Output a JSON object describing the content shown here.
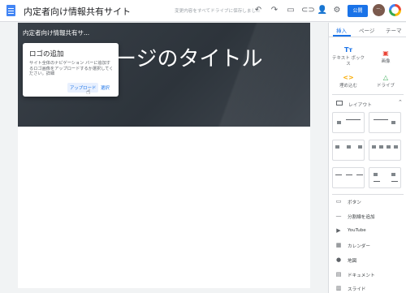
{
  "app": {
    "site_title": "内定者向け情報共有サイト",
    "save_status": "変更内容をすべてドライブに保存しました",
    "publish_label": "公開",
    "avatar_text": "ー·",
    "colors": {
      "accent": "#1a73e8",
      "banner": "#363d44",
      "doc_icon": "#4285f4"
    },
    "toolbar_icons": [
      "undo-icon",
      "redo-icon",
      "preview-devices-icon",
      "insert-link-icon",
      "add-editor-icon",
      "settings-icon",
      "more-vert-icon"
    ]
  },
  "canvas": {
    "banner_site_name": "内定者向け情報共有サ...",
    "page_title": "ージのタイトル"
  },
  "dialog": {
    "title": "ロゴの追加",
    "body": "サイト全体のナビゲーション バーに追加するロゴ画像をアップロードするか選択してください。詳細",
    "upload_label": "アップロード",
    "select_label": "選択"
  },
  "panel": {
    "tabs": [
      "挿入",
      "ページ",
      "テーマ"
    ],
    "active_tab": "挿入",
    "insert_tiles": [
      {
        "icon": "Tт",
        "label": "テキスト ボック ス",
        "color": "#1a73e8"
      },
      {
        "icon": "▣",
        "label": "画像",
        "color": "#ea4335"
      },
      {
        "icon": "<>",
        "label": "埋め込む",
        "color": "#f9ab00"
      },
      {
        "icon": "△",
        "label": "ドライブ",
        "color": "#34a853"
      }
    ],
    "layout_label": "レイアウト",
    "components": [
      {
        "icon": "▭",
        "label": "ボタン"
      },
      {
        "icon": "—",
        "label": "分割線を追加"
      },
      {
        "icon": "▶",
        "label": "YouTube"
      },
      {
        "icon": "▦",
        "label": "カレンダー"
      },
      {
        "icon": "●",
        "label": "地図"
      },
      {
        "icon": "▤",
        "label": "ドキュメント"
      },
      {
        "icon": "▥",
        "label": "スライド"
      }
    ]
  }
}
